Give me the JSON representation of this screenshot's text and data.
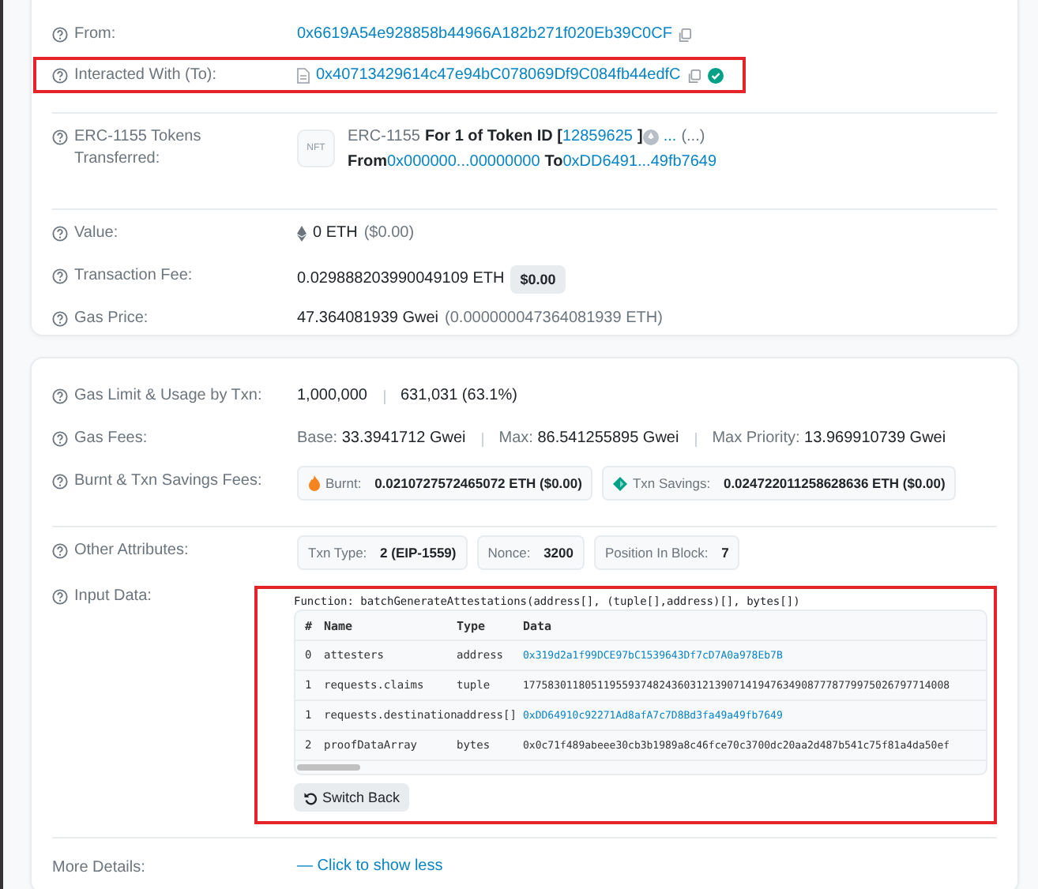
{
  "from": {
    "label": "From:",
    "address": "0x6619A54e928858b44966A182b271f020Eb39C0CF"
  },
  "interacted": {
    "label": "Interacted With (To):",
    "address": "0x40713429614c47e94bC078069Df9C084fb44edfC",
    "verified": true,
    "highlighted": true
  },
  "token_transfer": {
    "label": "ERC-1155 Tokens Transferred:",
    "badge": "NFT",
    "standard": "ERC-1155",
    "for_text": "For 1 of Token ID [",
    "token_id": "12859625",
    "close_bracket": "]",
    "token_name": "...",
    "token_symbol": "(...)",
    "from_word": "From",
    "from_address": "0x000000...00000000",
    "to_word": "To",
    "to_address": "0xDD6491...49fb7649"
  },
  "value": {
    "label": "Value:",
    "amount": "0 ETH",
    "usd": "($0.00)"
  },
  "fee": {
    "label": "Transaction Fee:",
    "amount": "0.029888203990049109 ETH",
    "usd": "$0.00"
  },
  "gas_price": {
    "label": "Gas Price:",
    "amount": "47.364081939 Gwei",
    "eth": "(0.000000047364081939 ETH)"
  },
  "gas_limit": {
    "label": "Gas Limit & Usage by Txn:",
    "limit": "1,000,000",
    "usage": "631,031 (63.1%)"
  },
  "gas_fees": {
    "label": "Gas Fees:",
    "parts": [
      {
        "key": "Base:",
        "value": "33.3941712 Gwei"
      },
      {
        "key": "Max:",
        "value": "86.541255895 Gwei"
      },
      {
        "key": "Max Priority:",
        "value": "13.969910739 Gwei"
      }
    ]
  },
  "burnt": {
    "label": "Burnt & Txn Savings Fees:",
    "pills": [
      {
        "kind": "burnt",
        "key": "Burnt:",
        "value": "0.0210727572465072 ETH ($0.00)"
      },
      {
        "kind": "savings",
        "key": "Txn Savings:",
        "value": "0.024722011258628636 ETH ($0.00)"
      }
    ]
  },
  "other": {
    "label": "Other Attributes:",
    "pills": [
      {
        "key": "Txn Type:",
        "value": "2 (EIP-1559)"
      },
      {
        "key": "Nonce:",
        "value": "3200"
      },
      {
        "key": "Position In Block:",
        "value": "7"
      }
    ]
  },
  "input_data": {
    "label": "Input Data:",
    "highlighted": true,
    "function": "Function: batchGenerateAttestations(address[], (tuple[],address)[], bytes[])",
    "columns": [
      "#",
      "Name",
      "Type",
      "Data"
    ],
    "rows": [
      {
        "index": "0",
        "name": "attesters",
        "type": "address",
        "data": "0x319d2a1f99DCE97bC1539643Df7cD7A0a978Eb7B",
        "link": true
      },
      {
        "index": "1",
        "name": "requests.claims",
        "type": "tuple",
        "data": "177583011805119559374824360312139071419476349087778779975026797714008",
        "link": false
      },
      {
        "index": "1",
        "name": "requests.destination",
        "type": "address[]",
        "data": "0xDD64910c92271Ad8afA7c7D8Bd3fa49a49fb7649",
        "link": true
      },
      {
        "index": "2",
        "name": "proofDataArray",
        "type": "bytes",
        "data": "0x0c71f489abeee30cb3b1989a8c46fce70c3700dc20aa2d487b541c75f81a4da50ef",
        "link": false
      }
    ],
    "button": "Switch Back"
  },
  "more": {
    "label": "More Details:",
    "link": "— Click to show less"
  }
}
